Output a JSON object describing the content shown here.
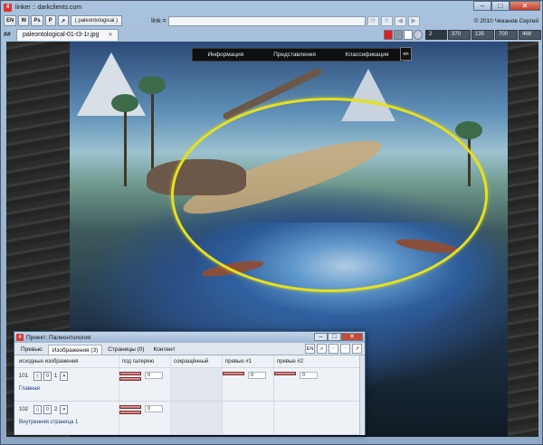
{
  "window": {
    "title": "linker :: darkclients.com",
    "minimize": "–",
    "maximize": "□",
    "close": "✕"
  },
  "toolbar": {
    "btn_en": "EN",
    "btn_w": "W",
    "btn_ps": "Ps",
    "btn_p": "P",
    "btn_edit": "↗",
    "project_label": "( paleontological )",
    "link_label": "link =",
    "link_value": "",
    "copyright": "© 2010 Чеканов Сергей"
  },
  "tabs": {
    "hash": "##",
    "items": [
      {
        "label": "paleontological-01-t3-1r.jpg",
        "close": "✕"
      }
    ],
    "counters": [
      "2",
      "370",
      "135",
      "700",
      "468"
    ]
  },
  "site": {
    "nav": [
      "Информация",
      "Представления",
      "Классификация"
    ],
    "lang": "en"
  },
  "panel": {
    "title": "Проект: Палеонтология",
    "tabs": [
      "Превью",
      "Изображения (3)",
      "Страницы (0)",
      "Контент"
    ],
    "tools": {
      "en": "EN",
      "next": ">"
    },
    "columns": [
      "исходные изображения",
      "под галерею",
      "сокращённый",
      "превью #1",
      "превью #2"
    ],
    "rows": [
      {
        "id": "101",
        "num": "1",
        "name": "Главная",
        "gallery_count": "0",
        "preview1_count": "0",
        "preview2_count": "0"
      },
      {
        "id": "102",
        "num": "2",
        "name": "Внутренняя страница 1",
        "gallery_count": "0",
        "preview1_count": "",
        "preview2_count": ""
      }
    ]
  },
  "colors": {
    "selection_ellipse": "#e6e020",
    "close_button": "#c94a36"
  }
}
